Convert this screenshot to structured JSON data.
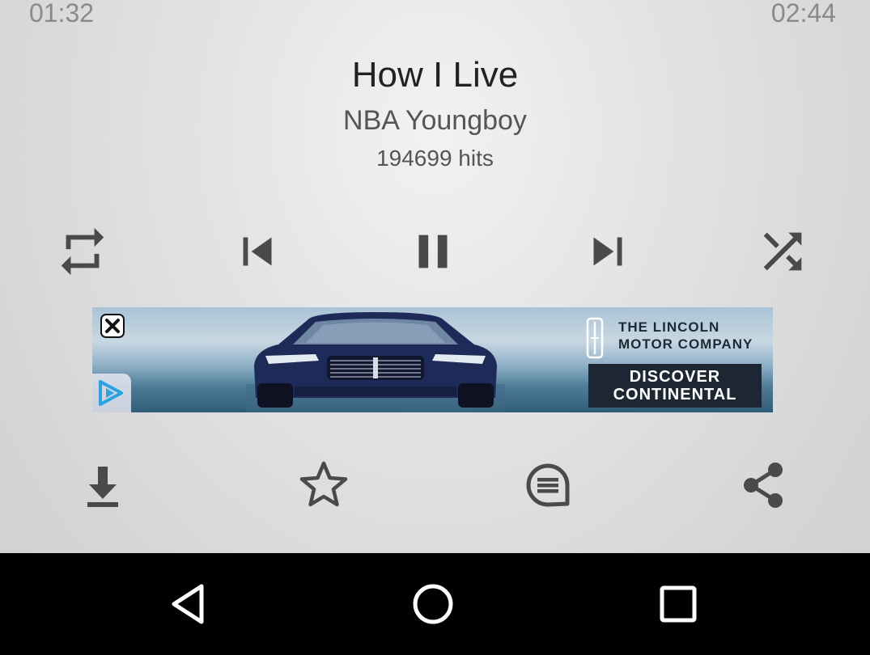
{
  "player": {
    "elapsed_time": "01:32",
    "total_time": "02:44",
    "song_title": "How I Live",
    "artist": "NBA Youngboy",
    "hits": "194699 hits"
  },
  "controls": {
    "repeat_icon": "repeat-icon",
    "previous_icon": "skip-previous-icon",
    "pause_icon": "pause-icon",
    "next_icon": "skip-next-icon",
    "shuffle_icon": "shuffle-icon"
  },
  "ad": {
    "brand_line1": "THE LINCOLN",
    "brand_line2": "MOTOR COMPANY",
    "cta_line1": "DISCOVER",
    "cta_line2": "CONTINENTAL"
  },
  "actions": {
    "download_icon": "download-icon",
    "favorite_icon": "star-icon",
    "comments_icon": "comment-icon",
    "share_icon": "share-icon"
  },
  "navbar": {
    "back_icon": "back-triangle-icon",
    "home_icon": "home-circle-icon",
    "recents_icon": "recents-square-icon"
  },
  "colors": {
    "icon": "#4a4a4a",
    "navbar": "#000000",
    "ad_cta_bg": "#1c2733"
  }
}
